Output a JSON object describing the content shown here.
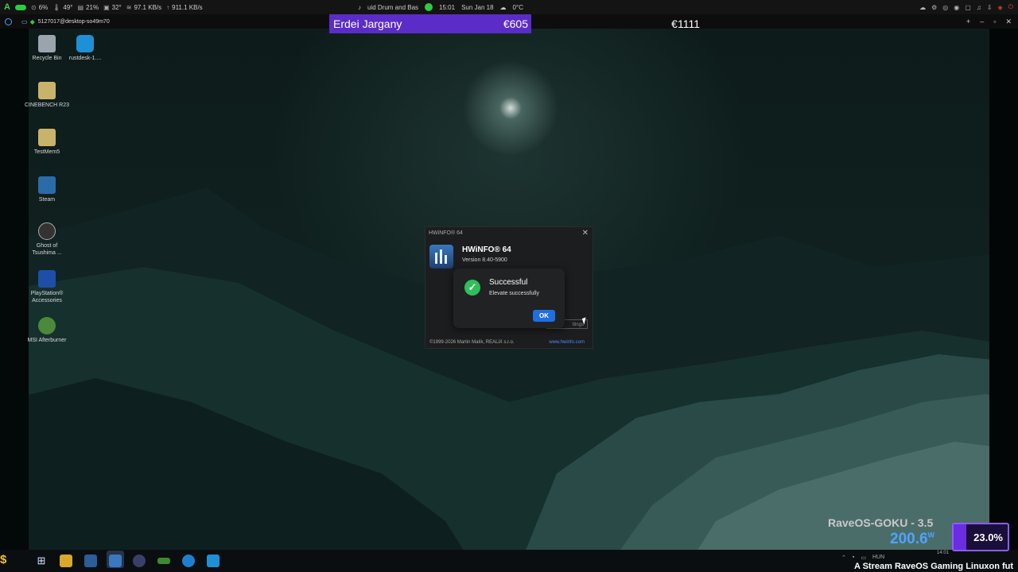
{
  "top_panel": {
    "cpu": "6%",
    "temp1": "49°",
    "mem": "21%",
    "temp2": "32°",
    "down": "97.1 KB/s",
    "up": "911.1 KB/s",
    "media": "uid Drum and Bas",
    "time": "15:01",
    "date": "Sun Jan 18",
    "weather": "0°C"
  },
  "remote_bar": {
    "host": "5127017@desktop-so49m70"
  },
  "stream_overlay": {
    "donor_name": "Erdei Jargany",
    "donor_amount": "€605",
    "goal_amount": "€1111",
    "osd_name": "RaveOS-GOKU - 3.5",
    "osd_watts": "200.6",
    "osd_watts_unit": "W",
    "osd_percent": "23.0%",
    "osd_percent_value": 0.23,
    "ticker": "A Stream RaveOS Gaming Linuxon fut"
  },
  "desktop_icons": [
    {
      "label": "Recycle Bin",
      "icon": "recycle-bin-icon",
      "color": "#9aa4ad"
    },
    {
      "label": "rustdesk-1....",
      "icon": "rustdesk-icon",
      "color": "#1e90d6"
    },
    {
      "label": "CINEBENCH R23",
      "icon": "folder-icon",
      "color": "#c9b36a"
    },
    {
      "label": "TestMem5",
      "icon": "folder-icon",
      "color": "#c9b36a"
    },
    {
      "label": "Steam",
      "icon": "steam-icon",
      "color": "#2a6ca8"
    },
    {
      "label": "Ghost of Tsushima ...",
      "icon": "ghost-of-tsushima-icon",
      "color": "#333333"
    },
    {
      "label": "PlayStation® Accessories",
      "icon": "playstation-icon",
      "color": "#1d4fa8"
    },
    {
      "label": "MSI Afterburner",
      "icon": "msi-afterburner-icon",
      "color": "#4a8a3a"
    }
  ],
  "hwinfo": {
    "window_title": "HWiNFO® 64",
    "app_name": "HWiNFO® 64",
    "version": "Version 8.40-5900",
    "settings_label": "ttings",
    "copyright": "©1999-2026 Martin Malík, REALiX s.r.o.",
    "url": "www.hwinfo.com"
  },
  "dialog": {
    "title": "Successful",
    "message": "Elevate successfully",
    "ok_label": "OK",
    "accent": "#1f6fe0",
    "success_color": "#2fbf5a"
  },
  "tray": {
    "lang": "HUN",
    "time": "14:01"
  }
}
